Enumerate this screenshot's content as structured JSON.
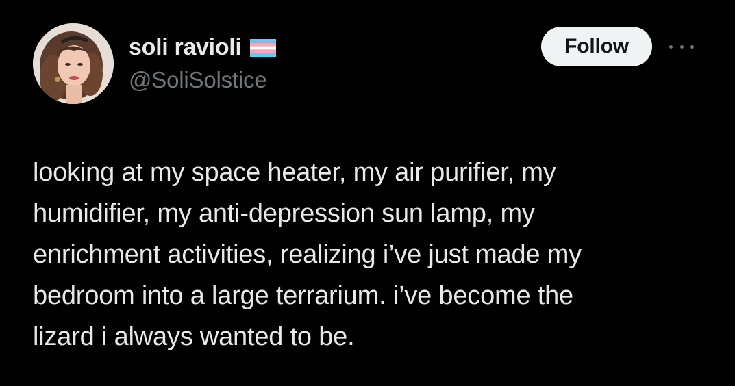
{
  "user": {
    "display_name": "soli ravioli",
    "handle": "@SoliSolstice",
    "flag_icon": "transgender-flag-icon",
    "flag_colors": [
      "#5bcefa",
      "#f5a9b8",
      "#ffffff",
      "#f5a9b8",
      "#5bcefa"
    ]
  },
  "actions": {
    "follow_label": "Follow",
    "more_icon": "more-horizontal-icon"
  },
  "tweet": {
    "lines": [
      "looking at my space heater, my air purifier, my",
      "humidifier, my anti-depression sun lamp, my",
      "enrichment activities, realizing i’ve just made my",
      "bedroom into a large terrarium. i’ve become the",
      "lizard i always wanted to be."
    ]
  },
  "colors": {
    "background": "#000000",
    "text_primary": "#e7e9ea",
    "text_secondary": "#71767b",
    "button_bg": "#eff3f4",
    "button_text": "#0f1419"
  }
}
